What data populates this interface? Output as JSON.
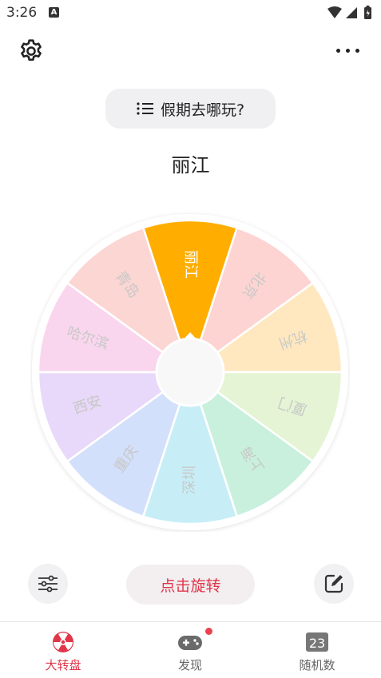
{
  "status": {
    "time": "3:26",
    "indicator": "A"
  },
  "header": {
    "settings_icon": "gear-icon",
    "more_icon": "more-horizontal-icon"
  },
  "topic": {
    "icon": "list-icon",
    "label": "假期去哪玩?"
  },
  "result": "丽江",
  "wheel": {
    "segments": [
      {
        "label": "丽江",
        "color": "#ffae00",
        "text_color": "#ffffff"
      },
      {
        "label": "北京",
        "color": "#fdd4d2",
        "text_color": "#c8c8c8"
      },
      {
        "label": "杭州",
        "color": "#ffe8bf",
        "text_color": "#c8c8c8"
      },
      {
        "label": "厦门",
        "color": "#e4f4d4",
        "text_color": "#c8c8c8"
      },
      {
        "label": "上海",
        "color": "#c9f0dd",
        "text_color": "#c8c8c8"
      },
      {
        "label": "深圳",
        "color": "#c7eef7",
        "text_color": "#c8c8c8"
      },
      {
        "label": "重庆",
        "color": "#d3e0fb",
        "text_color": "#c8c8c8"
      },
      {
        "label": "西安",
        "color": "#e8d8f9",
        "text_color": "#c8c8c8"
      },
      {
        "label": "哈尔滨",
        "color": "#fad6ee",
        "text_color": "#c8c8c8"
      },
      {
        "label": "青岛",
        "color": "#fbd6d3",
        "text_color": "#c8c8c8"
      }
    ]
  },
  "actions": {
    "filter_icon": "sliders-icon",
    "spin_label": "点击旋转",
    "edit_icon": "edit-icon"
  },
  "nav": {
    "items": [
      {
        "label": "大转盘",
        "icon": "wheel-icon",
        "active": true
      },
      {
        "label": "发现",
        "icon": "gamepad-icon",
        "active": false
      },
      {
        "label": "随机数",
        "icon": "calendar-number-icon",
        "badge": "23",
        "active": false
      }
    ]
  },
  "colors": {
    "accent": "#e0364a",
    "nav_active": "#e0364a",
    "nav_inactive": "#666666"
  }
}
